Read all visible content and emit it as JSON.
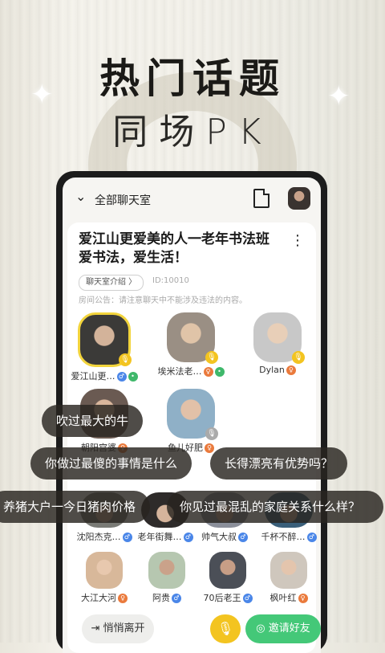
{
  "promo": {
    "headline": "热门话题",
    "subheadline": "同场PK"
  },
  "topbar": {
    "title": "全部聊天室"
  },
  "room": {
    "name": "爱江山更爱美的人一老年书法班爱书法，爱生活！",
    "tag": "聊天室介绍 〉",
    "id": "ID:10010",
    "notice": "房间公告：请注意聊天中不能涉及违法的内容。"
  },
  "seats": [
    {
      "name": "爱江山更…",
      "face": "#3b3a38"
    },
    {
      "name": "埃米法老…",
      "face": "#9a8f84"
    },
    {
      "name": "Dylan",
      "face": "#c8c8c8"
    },
    {
      "name": "朝阳宫婆",
      "face": "#6a5a52"
    },
    {
      "name": "鱼儿好肥",
      "face": "#8fb0c7"
    },
    {
      "name": "沈阳杰克…",
      "face": "#7a7b76"
    },
    {
      "name": "老年街舞…",
      "face": "#2e2b2a"
    },
    {
      "name": "帅气大叔",
      "face": "#8b8f9a"
    },
    {
      "name": "千杯不醉…",
      "face": "#3a5f7a"
    },
    {
      "name": "大江大河",
      "face": "#d8b89a"
    },
    {
      "name": "阿贵",
      "face": "#b6c7b0"
    },
    {
      "name": "70后老王",
      "face": "#4b4f57"
    },
    {
      "name": "枫叶红",
      "face": "#cfc7bd"
    }
  ],
  "bubbles": [
    "吹过最大的牛",
    "你做过最傻的事情是什么",
    "长得漂亮有优势吗？",
    "养猪大户一今日猪肉价格",
    "你见过最混乱的家庭关系什么样？"
  ],
  "bottom": {
    "leave": "悄悄离开",
    "invite": "邀请好友"
  }
}
